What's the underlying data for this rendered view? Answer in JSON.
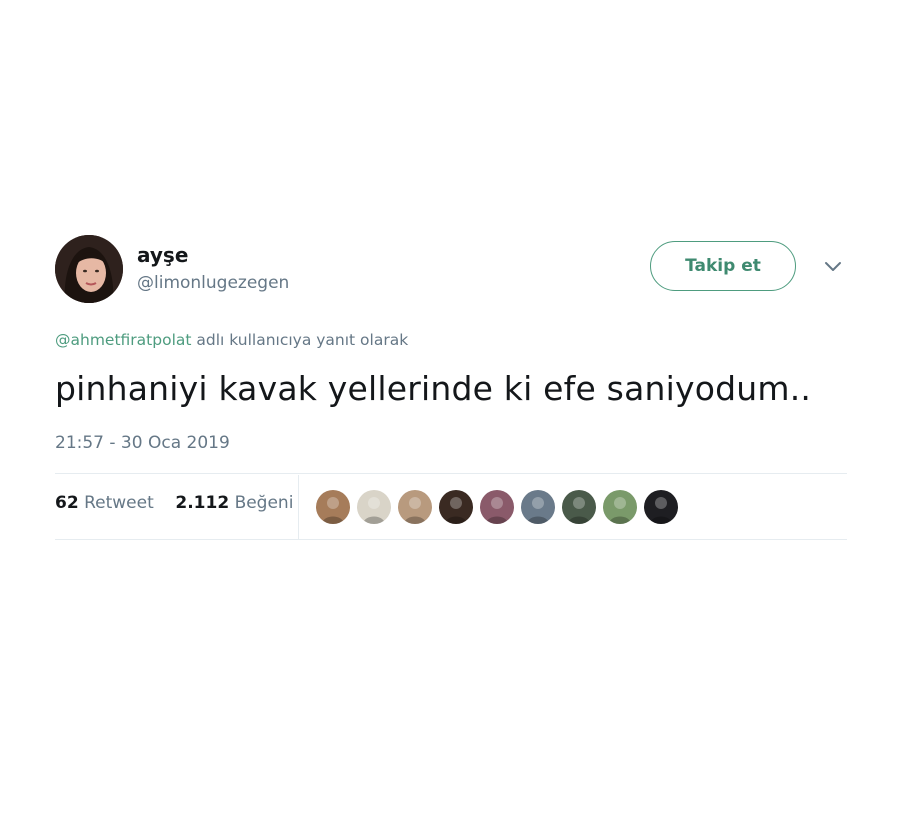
{
  "user": {
    "display_name": "ayşe",
    "handle": "@limonlugezegen",
    "avatar_icon": "profile-photo-icon"
  },
  "actions": {
    "follow_label": "Takip et",
    "more_icon": "chevron-down-icon"
  },
  "reply": {
    "mention": "@ahmetfiratpolat",
    "suffix": " adlı kullanıcıya yanıt olarak"
  },
  "tweet": {
    "text": "pinhaniyi kavak yellerinde ki efe saniyodum..",
    "timestamp": "21:57 - 30 Oca 2019"
  },
  "stats": {
    "retweet_count": "62",
    "retweet_label": "Retweet",
    "like_count": "2.112",
    "like_label": "Beğeni"
  },
  "likers": [
    {
      "icon": "liker-avatar-icon",
      "color": "#a67c5a"
    },
    {
      "icon": "liker-avatar-icon",
      "color": "#d9d4c8"
    },
    {
      "icon": "liker-avatar-icon",
      "color": "#b89a7e"
    },
    {
      "icon": "liker-avatar-icon",
      "color": "#3a2a22"
    },
    {
      "icon": "liker-avatar-icon",
      "color": "#8a5a6a"
    },
    {
      "icon": "liker-avatar-icon",
      "color": "#6a7a8a"
    },
    {
      "icon": "liker-avatar-icon",
      "color": "#4a5a4a"
    },
    {
      "icon": "liker-avatar-icon",
      "color": "#7a9a6a"
    },
    {
      "icon": "liker-avatar-icon",
      "color": "#1e1e22"
    }
  ],
  "colors": {
    "accent": "#4e9c7f",
    "text": "#14171a",
    "muted": "#657786",
    "border": "#e6ecf0"
  }
}
